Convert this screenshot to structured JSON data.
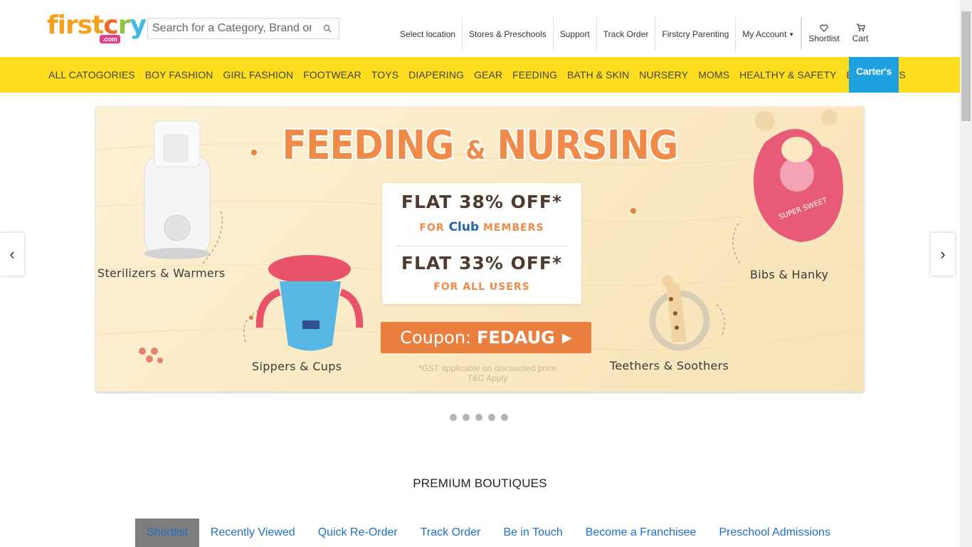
{
  "header": {
    "logo": {
      "part1": "first",
      "part2": "c",
      "part3": "r",
      "part4": "y",
      "com": ".com"
    },
    "search": {
      "placeholder": "Search for a Category, Brand or Product"
    },
    "links": {
      "location": "Select location",
      "stores": "Stores & Preschools",
      "support": "Support",
      "track": "Track Order",
      "parenting": "Firstcry Parenting",
      "account": "My Account",
      "shortlist": "Shortlist",
      "cart": "Cart"
    }
  },
  "nav": {
    "items": [
      "ALL CATOGORIES",
      "BOY FASHION",
      "GIRL FASHION",
      "FOOTWEAR",
      "TOYS",
      "DIAPERING",
      "GEAR",
      "FEEDING",
      "BATH & SKIN",
      "NURSERY",
      "MOMS",
      "HEALTHY & SAFETY",
      "BOUTIQUES"
    ],
    "carters": "Carter's"
  },
  "banner": {
    "title_a": "FEEDING",
    "title_amp": "&",
    "title_b": "NURSING",
    "offer1": "FLAT 38% OFF*",
    "offer1_for": "FOR",
    "offer1_club": "Club",
    "offer1_members": "MEMBERS",
    "offer2": "FLAT 33% OFF*",
    "offer2_sub": "FOR ALL USERS",
    "coupon_label": "Coupon:",
    "coupon_code": "FEDAUG",
    "gst_line1": "*GST applicable on discounted price",
    "gst_line2": "T&C Apply",
    "products": {
      "sterilizers": "Sterilizers & Warmers",
      "sippers": "Sippers & Cups",
      "teethers": "Teethers & Soothers",
      "bibs": "Bibs & Hanky"
    },
    "bib_text": "SUPER SWEET"
  },
  "carousel": {
    "prev": "‹",
    "next": "›",
    "slide_count": 5
  },
  "section_title": "PREMIUM BOUTIQUES",
  "bottom_tabs": [
    "Shortlist",
    "Recently Viewed",
    "Quick Re-Order",
    "Track Order",
    "Be in Touch",
    "Become a Franchisee",
    "Preschool Admissions"
  ],
  "colors": {
    "nav_bg": "#fedc1e",
    "carters_bg": "#1ea0e1",
    "link_blue": "#1e6ec8",
    "banner_orange": "#ef8a48"
  }
}
